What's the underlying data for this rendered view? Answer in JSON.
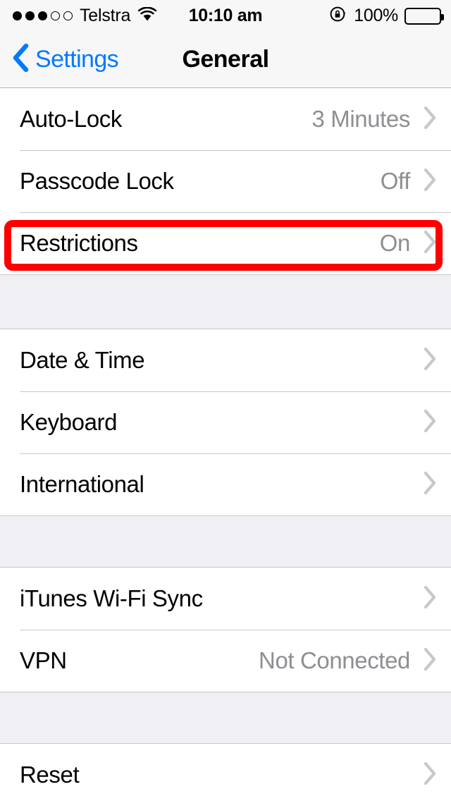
{
  "status_bar": {
    "signal_filled": 3,
    "signal_total": 5,
    "carrier": "Telstra",
    "wifi_icon": "wifi-icon",
    "time": "10:10 am",
    "rotation_lock_icon": "rotation-lock-icon",
    "battery_percent": "100%",
    "battery_level": 100
  },
  "nav_bar": {
    "back_icon": "chevron-left-icon",
    "back_label": "Settings",
    "title": "General"
  },
  "colors": {
    "accent_blue": "#007AFF",
    "value_gray": "#8E8E93",
    "chevron_gray": "#C7C7CC",
    "separator": "#C8C7CC",
    "group_background": "#EFEFF4",
    "highlight_red": "#FF0000"
  },
  "groups": [
    {
      "rows": [
        {
          "label": "Auto-Lock",
          "value": "3 Minutes",
          "chevron": "chevron-right-icon",
          "highlighted": false
        },
        {
          "label": "Passcode Lock",
          "value": "Off",
          "chevron": "chevron-right-icon",
          "highlighted": false
        },
        {
          "label": "Restrictions",
          "value": "On",
          "chevron": "chevron-right-icon",
          "highlighted": true
        }
      ]
    },
    {
      "rows": [
        {
          "label": "Date & Time",
          "value": "",
          "chevron": "chevron-right-icon",
          "highlighted": false
        },
        {
          "label": "Keyboard",
          "value": "",
          "chevron": "chevron-right-icon",
          "highlighted": false
        },
        {
          "label": "International",
          "value": "",
          "chevron": "chevron-right-icon",
          "highlighted": false
        }
      ]
    },
    {
      "rows": [
        {
          "label": "iTunes Wi-Fi Sync",
          "value": "",
          "chevron": "chevron-right-icon",
          "highlighted": false
        },
        {
          "label": "VPN",
          "value": "Not Connected",
          "chevron": "chevron-right-icon",
          "highlighted": false
        }
      ]
    },
    {
      "rows": [
        {
          "label": "Reset",
          "value": "",
          "chevron": "chevron-right-icon",
          "highlighted": false
        }
      ]
    }
  ]
}
